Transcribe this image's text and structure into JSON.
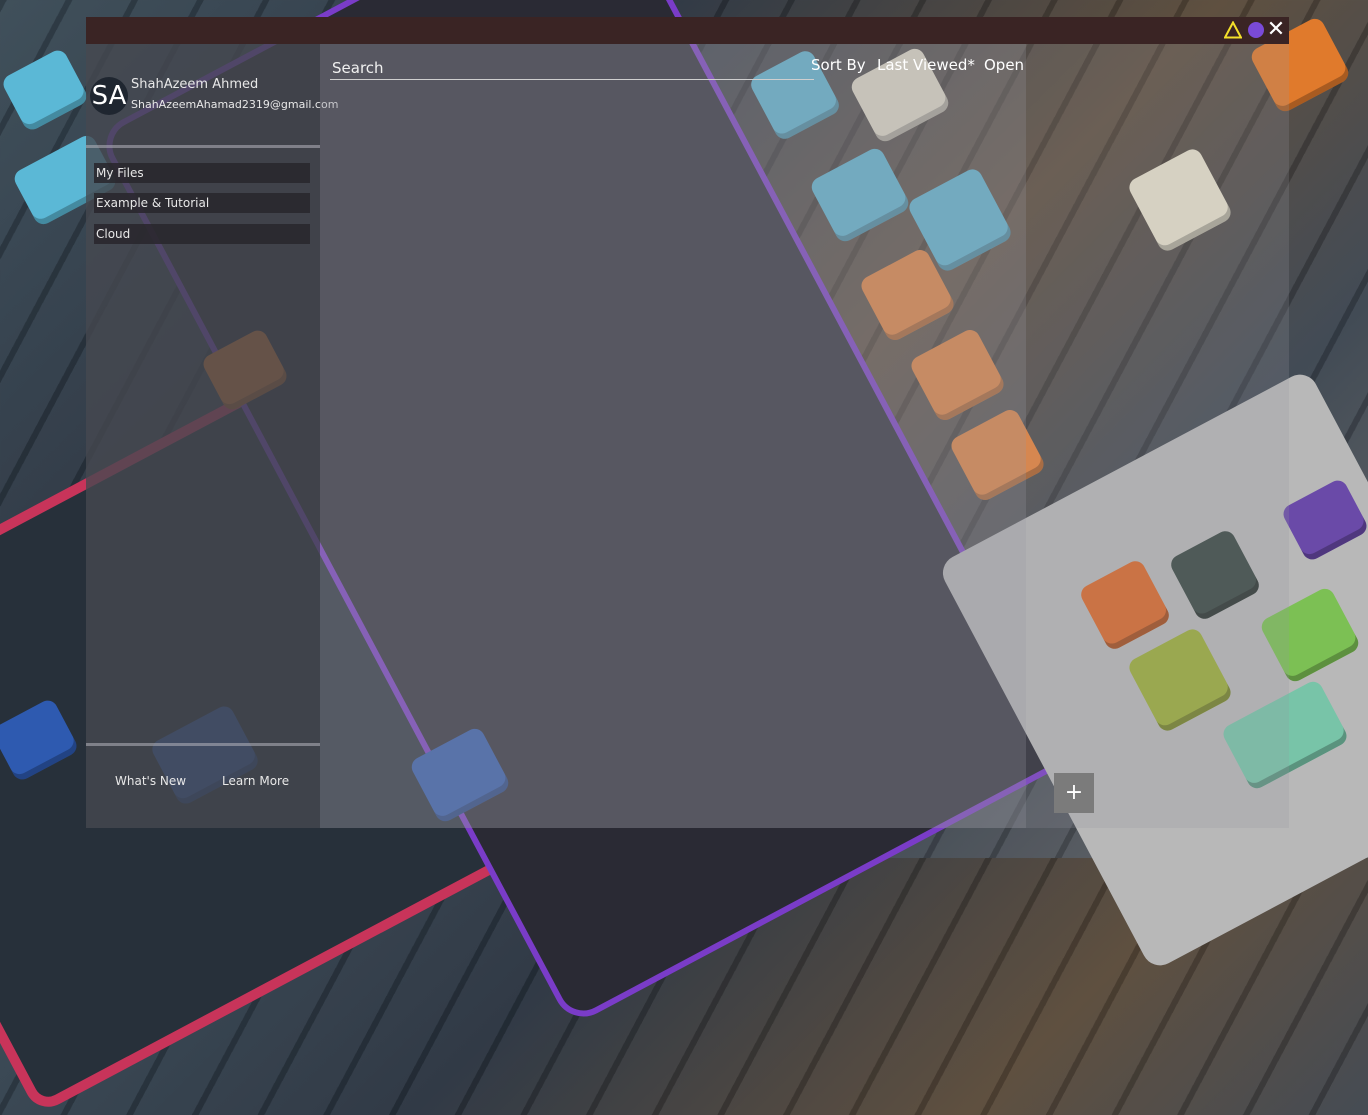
{
  "titlebar": {
    "icons": [
      "warning-triangle-icon",
      "circle-icon",
      "close-icon"
    ],
    "close_glyph": "✕",
    "accent_color": "#7a4ad8",
    "bar_color": "#3a2424"
  },
  "profile": {
    "initials": "SA",
    "name": "ShahAzeem Ahmed",
    "email": "ShahAzeemAhamad2319@gmail.com"
  },
  "sidebar": {
    "items": [
      {
        "label": "My Files"
      },
      {
        "label": "Example & Tutorial"
      },
      {
        "label": "Cloud"
      }
    ],
    "footer": {
      "whats_new": "What's New",
      "learn_more": "Learn More"
    }
  },
  "toolbar": {
    "search_placeholder": "Search",
    "sort_label": "Sort By",
    "sort_value": "Last Viewed*",
    "open_label": "Open"
  },
  "actions": {
    "add_label": "+"
  }
}
